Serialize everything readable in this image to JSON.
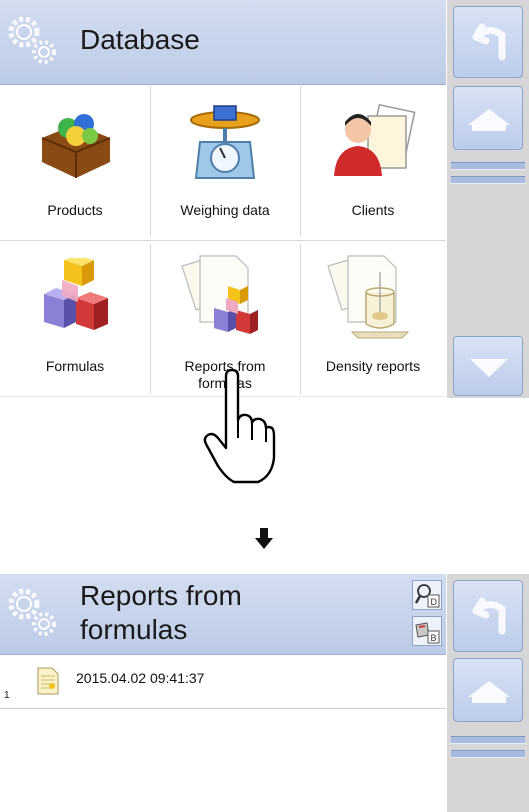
{
  "top": {
    "title": "Database",
    "tiles": [
      {
        "label": "Products",
        "icon": "products-box-icon"
      },
      {
        "label": "Weighing data",
        "icon": "weighing-scale-icon"
      },
      {
        "label": "Clients",
        "icon": "clients-person-icon"
      },
      {
        "label": "Formulas",
        "icon": "formula-cubes-icon"
      },
      {
        "label": "Reports from formulas",
        "icon": "formula-reports-icon"
      },
      {
        "label": "Density reports",
        "icon": "density-reports-icon"
      }
    ]
  },
  "arrow_icon": "down-arrow-icon",
  "bottom": {
    "title_line1": "Reports from",
    "title_line2": "formulas",
    "records": [
      {
        "index": "1",
        "datetime": "2015.04.02 09:41:37"
      }
    ]
  }
}
